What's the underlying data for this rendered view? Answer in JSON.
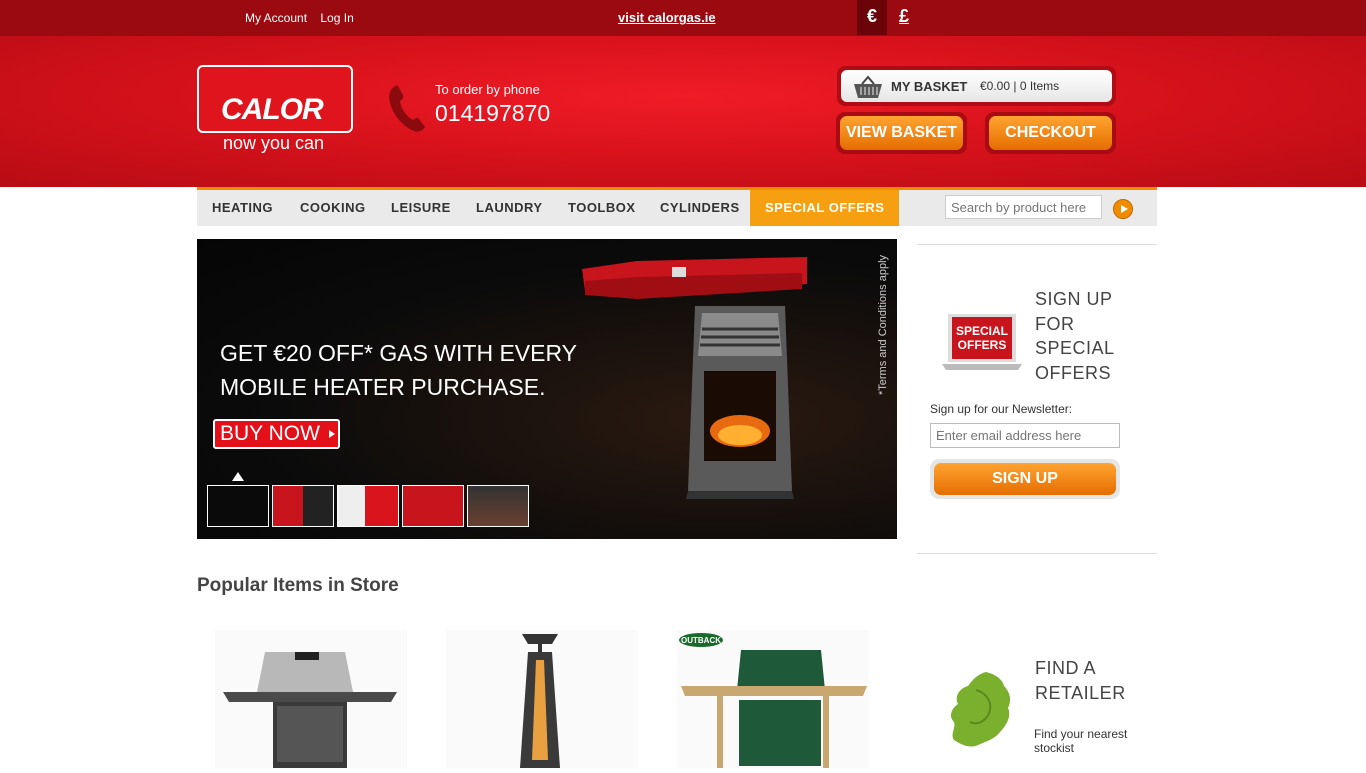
{
  "topbar": {
    "my_account": "My Account",
    "log_in": "Log In",
    "visit": "visit calorgas.ie",
    "currency_eur": "€",
    "currency_gbp": "£"
  },
  "header": {
    "logo_word": "CALOR",
    "logo_tagline": "now you can",
    "phone_label": "To order by phone",
    "phone_number": "014197870",
    "basket_label": "MY BASKET",
    "basket_summary": "€0.00 | 0 Items",
    "view_basket": "VIEW BASKET",
    "checkout": "CHECKOUT"
  },
  "nav": {
    "items": [
      "HEATING",
      "COOKING",
      "LEISURE",
      "LAUNDRY",
      "TOOLBOX",
      "CYLINDERS",
      "SPECIAL OFFERS"
    ],
    "search_placeholder": "Search by product here"
  },
  "banner": {
    "line1": "GET €20 OFF* GAS WITH EVERY",
    "line2": "MOBILE HEATER PURCHASE.",
    "buy_now": "BUY NOW",
    "terms": "*Terms and Conditions apply"
  },
  "signup": {
    "badge": "SPECIAL OFFERS",
    "title_lines": [
      "SIGN UP",
      "FOR",
      "SPECIAL",
      "OFFERS"
    ],
    "newsletter_label": "Sign up for our Newsletter:",
    "email_placeholder": "Enter email address here",
    "button": "SIGN UP"
  },
  "retailer": {
    "title_lines": [
      "FIND A",
      "RETAILER"
    ],
    "subtitle": "Find your nearest stockist"
  },
  "popular": {
    "title": "Popular Items in Store",
    "product3_badge": "OUTBACK"
  },
  "colors": {
    "topbar": "#9a0a10",
    "header": "#e0141c",
    "accent_orange": "#f08c00"
  }
}
